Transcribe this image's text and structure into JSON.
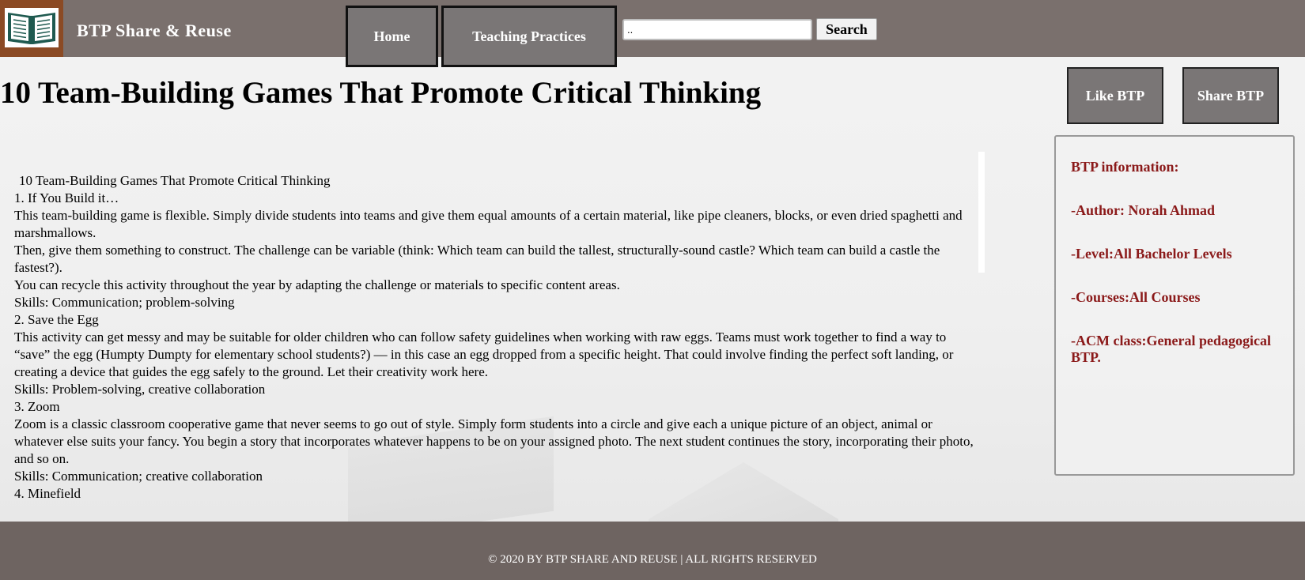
{
  "header": {
    "brand": "BTP Share & Reuse",
    "logo_icon": "book-icon",
    "nav": [
      {
        "label": "Home"
      },
      {
        "label": "Teaching Practices"
      }
    ],
    "search": {
      "value": "..",
      "button_label": "Search"
    }
  },
  "page": {
    "title": "10 Team-Building Games That Promote Critical Thinking",
    "like_label": "Like BTP",
    "share_label": "Share BTP"
  },
  "info": {
    "heading": "BTP information:",
    "author": "-Author: Norah Ahmad",
    "level": "-Level:All Bachelor Levels",
    "courses": "-Courses:All Courses",
    "acm": "-ACM class:General pedagogical BTP."
  },
  "article": {
    "lines": [
      "10 Team-Building Games That Promote Critical Thinking",
      "1. If You Build it…",
      "This team-building game is flexible. Simply divide students into teams and give them equal amounts of a certain material, like pipe cleaners, blocks, or even dried spaghetti and marshmallows.",
      "Then, give them something to construct. The challenge can be variable (think: Which team can build the tallest, structurally-sound castle? Which team can build a castle the fastest?).",
      "You can recycle this activity throughout the year by adapting the challenge or materials to specific content areas.",
      "Skills: Communication; problem-solving",
      "2. Save the Egg",
      "This activity can get messy and may be suitable for older children who can follow safety guidelines when working with raw eggs. Teams must work together to find a way to “save” the egg (Humpty Dumpty for elementary school students?) — in this case an egg dropped from a specific height. That could involve finding the perfect soft landing, or creating a device that guides the egg safely to the ground. Let their creativity work here.",
      "Skills: Problem-solving, creative collaboration",
      "3. Zoom",
      "Zoom is a classic classroom cooperative game that never seems to go out of style. Simply form students into a circle and give each a unique picture of an object, animal or whatever else suits your fancy. You begin a story that incorporates whatever happens to be on your assigned photo. The next student continues the story, incorporating their photo, and so on.",
      "Skills: Communication; creative collaboration",
      "4. Minefield"
    ]
  },
  "footer": {
    "text": "© 2020 BY BTP SHARE AND REUSE | ALL RIGHTS RESERVED"
  },
  "colors": {
    "header_bg": "#7a706d",
    "logo_bg": "#8b4a24",
    "button_bg": "#7a7676",
    "info_text": "#8b1a1a",
    "footer_bg": "#6e6461"
  }
}
